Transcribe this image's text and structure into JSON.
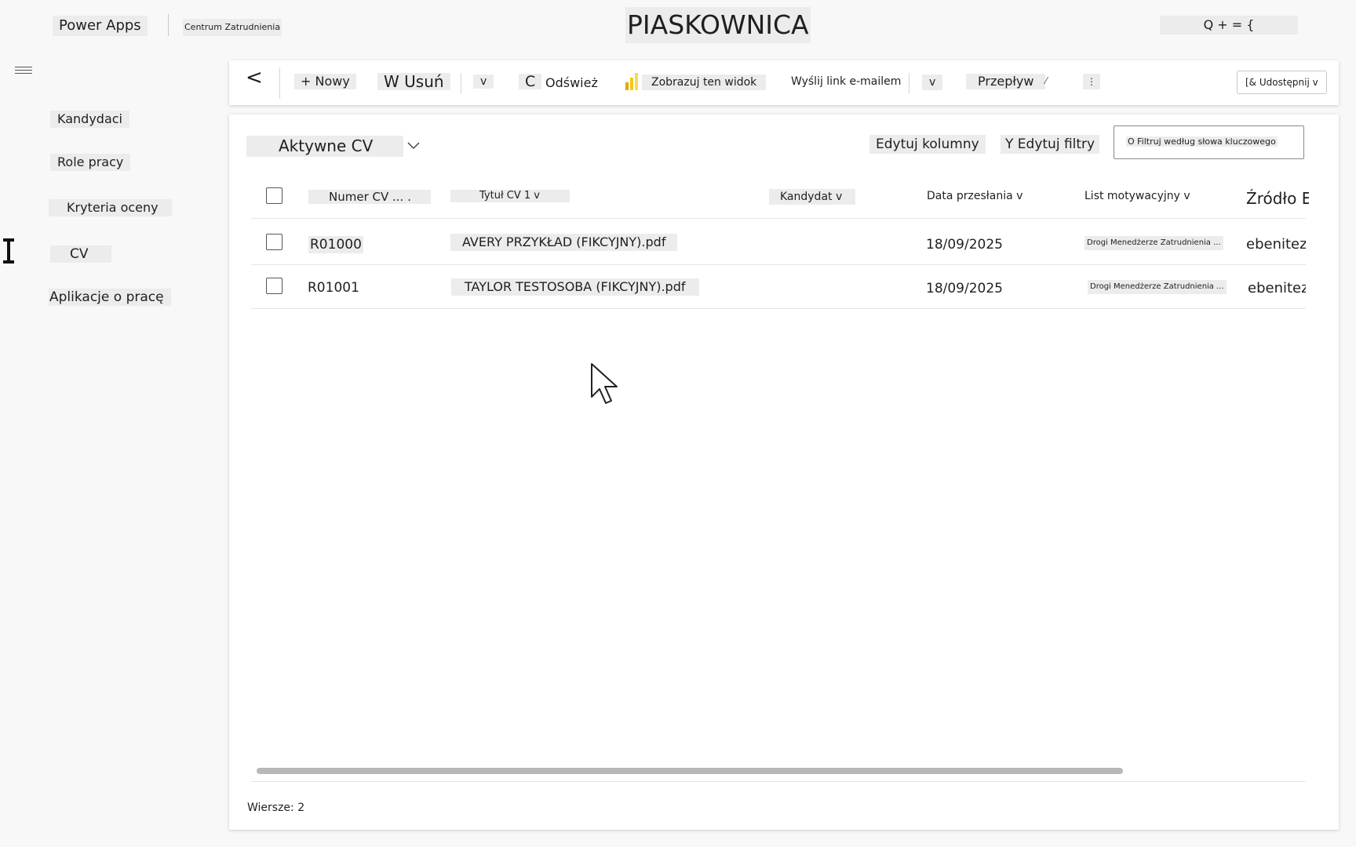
{
  "header": {
    "app_name": "Power Apps",
    "environment_name": "Centrum Zatrudnienia",
    "sandbox_label": "PIASKOWNICA",
    "icons_text": "Q + = {"
  },
  "nav": {
    "items": [
      {
        "label": "Kandydaci"
      },
      {
        "label": "Role pracy"
      },
      {
        "label": "Kryteria oceny"
      },
      {
        "label": "CV"
      },
      {
        "label": "Aplikacje o pracę"
      }
    ]
  },
  "toolbar": {
    "back": "<",
    "new": "+ Nowy",
    "delete": "W Usuń",
    "delete_more": "v",
    "refresh_icon": "C",
    "refresh": "Odśwież",
    "show_view": "Zobrazuj ten widok",
    "email_link": "Wyślij link e-mailem",
    "email_more": "v",
    "flow": "Przepływ",
    "flow_more": "⁄",
    "overflow": "⋮",
    "share": "[& Udostępnij v"
  },
  "view": {
    "title": "Aktywne CV",
    "edit_columns": "Edytuj kolumny",
    "edit_filters": "Y Edytuj filtry",
    "search_placeholder": "O Filtruj według słowa kluczowego"
  },
  "grid": {
    "columns": [
      "Numer CV ... .",
      "Tytuł CV 1 v",
      "Kandydat v",
      "Data przesłania v",
      "List motywacyjny v",
      "Źródło E"
    ],
    "rows": [
      {
        "number": "R01000",
        "title": "AVERY PRZYKŁAD (FIKCYJNY).pdf",
        "date": "18/09/2025",
        "cover_letter": "Drogi Menedżerze Zatrudnienia ...",
        "source": "ebenitez"
      },
      {
        "number": "R01001",
        "title": "TAYLOR TESTOSOBA (FIKCYJNY).pdf",
        "date": "18/09/2025",
        "cover_letter": "Drogi Menedżerze Zatrudnienia ...",
        "source": "ebenitez"
      }
    ]
  },
  "footer": {
    "row_count": "Wiersze: 2"
  },
  "colors": {
    "background": "#f8f8f8",
    "chip": "#ececec",
    "powerbi_icon": "#f2c811"
  }
}
